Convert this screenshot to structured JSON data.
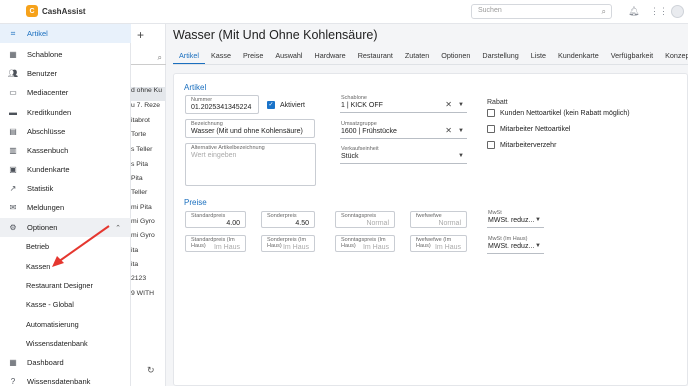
{
  "app": {
    "logo_text": "CashAssist"
  },
  "topbar": {
    "search_placeholder": "Suchen"
  },
  "sidebar": {
    "items": [
      {
        "label": "Artikel",
        "icon": "scan-icon"
      },
      {
        "label": "Schablone",
        "icon": "grid-icon"
      },
      {
        "label": "Benutzer",
        "icon": "users-icon"
      },
      {
        "label": "Mediacenter",
        "icon": "media-icon"
      },
      {
        "label": "Kreditkunden",
        "icon": "card-icon"
      },
      {
        "label": "Abschlüsse",
        "icon": "receipt-icon"
      },
      {
        "label": "Kassenbuch",
        "icon": "book-icon"
      },
      {
        "label": "Kundenkarte",
        "icon": "id-card-icon"
      },
      {
        "label": "Statistik",
        "icon": "chart-icon"
      },
      {
        "label": "Meldungen",
        "icon": "mail-icon"
      },
      {
        "label": "Optionen",
        "icon": "gear-icon"
      }
    ],
    "sub_items": [
      "Betrieb",
      "Kassen",
      "Restaurant Designer",
      "Kasse - Global",
      "Automatisierung",
      "Wissensdatenbank"
    ],
    "bottom_items": [
      {
        "label": "Dashboard",
        "icon": "dashboard-icon"
      },
      {
        "label": "Wissensdatenbank",
        "icon": "help-icon"
      }
    ]
  },
  "list": {
    "rows": [
      "d ohne Ku",
      "u 7. Reze",
      "itabrot",
      "Torte",
      "s Teller",
      "s Pita",
      "Pita",
      "Teller",
      "mi Pita",
      "mi Gyro",
      "mi Gyro",
      "ita",
      "ita",
      "2123",
      "9 WITH"
    ]
  },
  "main": {
    "title": "Wasser (Mit Und Ohne Kohlensäure)",
    "tabs": [
      "Artikel",
      "Kasse",
      "Preise",
      "Auswahl",
      "Hardware",
      "Restaurant",
      "Zutaten",
      "Optionen",
      "Darstellung",
      "Liste",
      "Kundenkarte",
      "Verfügbarkeit",
      "Konzep"
    ]
  },
  "artikel": {
    "section_title": "Artikel",
    "nummer_label": "Nummer",
    "nummer_value": "01.2025341345224",
    "aktiviert_label": "Aktiviert",
    "bezeichnung_label": "Bezeichnung",
    "bezeichnung_value": "Wasser (Mit und ohne Kohlensäure)",
    "alt_label": "Alternative Artikelbezeichnung",
    "alt_placeholder": "Wert eingeben",
    "schablone_label": "Schablone",
    "schablone_value": "1 | KICK OFF",
    "umsatzgruppe_label": "Umsatzgruppe",
    "umsatzgruppe_value": "1600 | Frühstücke",
    "verkaufseinheit_label": "Verkaufseinheit",
    "verkaufseinheit_value": "Stück",
    "rabatt_label": "Rabatt",
    "rabatt_options": [
      "Kunden Nettoartikel (kein Rabatt möglich)",
      "Mitarbeiter Nettoartikel",
      "Mitarbeiterverzehr"
    ]
  },
  "preise": {
    "section_title": "Preise",
    "row1": [
      {
        "label": "Standardpreis",
        "value": "4.00"
      },
      {
        "label": "Sonderpreis",
        "value": "4.50"
      },
      {
        "label": "Sonntagspreis",
        "placeholder": "Normal"
      },
      {
        "label": "fwefwefwe",
        "placeholder": "Normal"
      }
    ],
    "row2": [
      {
        "label": "Standardpreis (Im Haus)",
        "placeholder": "Im Haus"
      },
      {
        "label": "Sonderpreis (Im Haus)",
        "placeholder": "Im Haus"
      },
      {
        "label": "Sonntagspreis (Im Haus)",
        "placeholder": "Im Haus"
      },
      {
        "label": "fwefwefwe (Im Haus)",
        "placeholder": "Im Haus"
      }
    ],
    "mwst_label": "MwSt",
    "mwst_value": "MWSt. reduz...",
    "mwst_haus_label": "MwSt (Im Haus)",
    "mwst_haus_value": "MWSt. reduz..."
  }
}
